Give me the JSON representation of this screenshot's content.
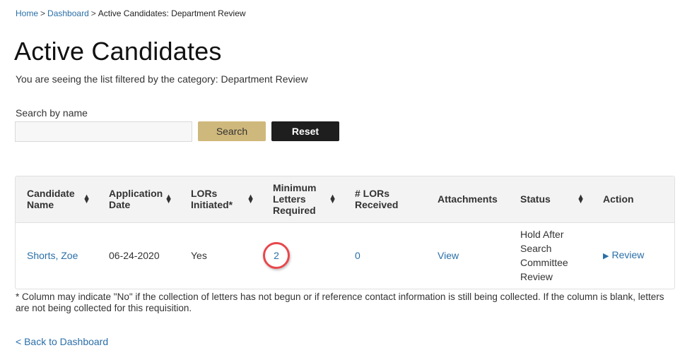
{
  "breadcrumb": {
    "items": [
      {
        "label": "Home",
        "link": true
      },
      {
        "label": "Dashboard",
        "link": true
      },
      {
        "label": "Active Candidates: Department Review",
        "link": false
      }
    ],
    "separator": ">"
  },
  "page": {
    "title": "Active Candidates",
    "subtitle": "You are seeing the list filtered by the category: Department Review"
  },
  "search": {
    "label": "Search by name",
    "value": "",
    "placeholder": "",
    "search_button": "Search",
    "reset_button": "Reset"
  },
  "table": {
    "columns": [
      {
        "label": "Candidate Name",
        "sortable": true
      },
      {
        "label": "Application Date",
        "sortable": true
      },
      {
        "label": "LORs Initiated*",
        "sortable": true
      },
      {
        "label": "Minimum Letters Required",
        "sortable": true
      },
      {
        "label": "# LORs Received",
        "sortable": false
      },
      {
        "label": "Attachments",
        "sortable": false
      },
      {
        "label": "Status",
        "sortable": true
      },
      {
        "label": "Action",
        "sortable": false
      }
    ],
    "rows": [
      {
        "candidate_name": "Shorts, Zoe",
        "application_date": "06-24-2020",
        "lors_initiated": "Yes",
        "minimum_letters_required": "2",
        "lors_received": "0",
        "attachments": "View",
        "status": "Hold After Search Committee Review",
        "action": "Review"
      }
    ]
  },
  "annotation": {
    "circle_color": "#e8474c"
  },
  "footnote": "* Column may indicate \"No\" if the collection of letters has not begun or if reference contact information is still being collected. If the column is blank, letters are not being collected for this requisition.",
  "back_link": "< Back to Dashboard",
  "colors": {
    "link": "#2a6fa8",
    "search_button": "#cfb87c",
    "reset_button": "#1e1e1e",
    "header_bg": "#f3f3f3"
  }
}
